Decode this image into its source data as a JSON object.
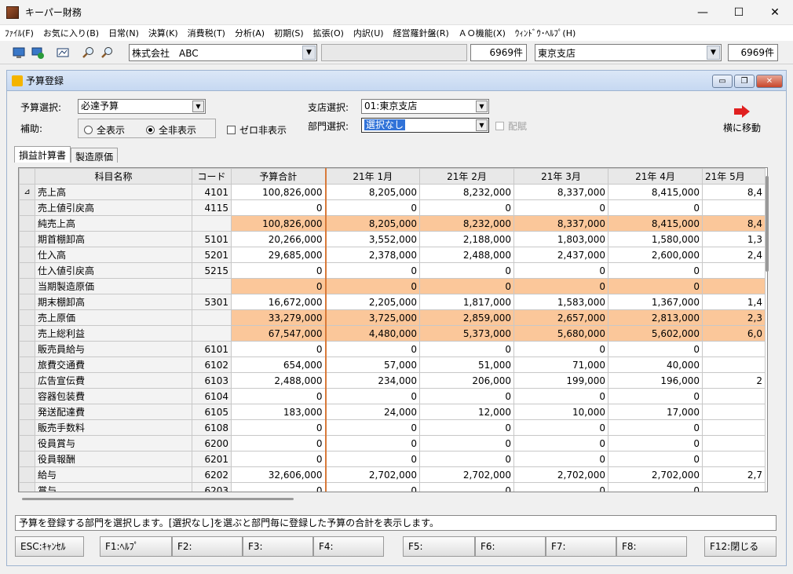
{
  "window": {
    "title": "キーパー財務",
    "min": "—",
    "max": "☐",
    "close": "✕"
  },
  "menu": [
    "ﾌｧｲﾙ(F)",
    "お気に入り(B)",
    "日常(N)",
    "決算(K)",
    "消費税(T)",
    "分析(A)",
    "初期(S)",
    "拡張(O)",
    "内訳(U)",
    "経営羅針盤(R)",
    "ＡＯ機能(X)",
    "ｳｨﾝﾄﾞｳ･ﾍﾙﾌﾟ(H)"
  ],
  "toolbar": {
    "company": "株式会社　ABC",
    "company_count": "6969件",
    "branch": "東京支店",
    "branch_count": "6969件"
  },
  "child": {
    "title": "予算登録"
  },
  "form": {
    "budget_label": "予算選択:",
    "budget_value": "必達予算",
    "aux_label": "補助:",
    "radio_all": "全表示",
    "radio_none": "全非表示",
    "zero_hide": "ゼロ非表示",
    "branch_label": "支店選択:",
    "branch_value": "01:東京支店",
    "dept_label": "部門選択:",
    "dept_value": "選択なし",
    "alloc": "配賦",
    "move_label": "横に移動"
  },
  "tabs": [
    "損益計算書",
    "製造原価"
  ],
  "grid": {
    "headers": [
      "科目名称",
      "コード",
      "予算合計",
      "21年 1月",
      "21年 2月",
      "21年 3月",
      "21年 4月",
      "21年 5月"
    ],
    "rows": [
      {
        "mark": "⊿",
        "name": "売上高",
        "code": "4101",
        "vals": [
          "100,826,000",
          "8,205,000",
          "8,232,000",
          "8,337,000",
          "8,415,000",
          "8,4"
        ],
        "hl": false
      },
      {
        "mark": "",
        "name": "売上値引戻高",
        "code": "4115",
        "vals": [
          "0",
          "0",
          "0",
          "0",
          "0",
          ""
        ],
        "hl": false
      },
      {
        "mark": "",
        "name": "純売上高",
        "code": "",
        "vals": [
          "100,826,000",
          "8,205,000",
          "8,232,000",
          "8,337,000",
          "8,415,000",
          "8,4"
        ],
        "hl": true
      },
      {
        "mark": "",
        "name": "期首棚卸高",
        "code": "5101",
        "vals": [
          "20,266,000",
          "3,552,000",
          "2,188,000",
          "1,803,000",
          "1,580,000",
          "1,3"
        ],
        "hl": false
      },
      {
        "mark": "",
        "name": "仕入高",
        "code": "5201",
        "vals": [
          "29,685,000",
          "2,378,000",
          "2,488,000",
          "2,437,000",
          "2,600,000",
          "2,4"
        ],
        "hl": false
      },
      {
        "mark": "",
        "name": "仕入値引戻高",
        "code": "5215",
        "vals": [
          "0",
          "0",
          "0",
          "0",
          "0",
          ""
        ],
        "hl": false
      },
      {
        "mark": "",
        "name": "当期製造原価",
        "code": "",
        "vals": [
          "0",
          "0",
          "0",
          "0",
          "0",
          ""
        ],
        "hl": true
      },
      {
        "mark": "",
        "name": "期末棚卸高",
        "code": "5301",
        "vals": [
          "16,672,000",
          "2,205,000",
          "1,817,000",
          "1,583,000",
          "1,367,000",
          "1,4"
        ],
        "hl": false
      },
      {
        "mark": "",
        "name": "売上原価",
        "code": "",
        "vals": [
          "33,279,000",
          "3,725,000",
          "2,859,000",
          "2,657,000",
          "2,813,000",
          "2,3"
        ],
        "hl": true
      },
      {
        "mark": "",
        "name": "売上総利益",
        "code": "",
        "vals": [
          "67,547,000",
          "4,480,000",
          "5,373,000",
          "5,680,000",
          "5,602,000",
          "6,0"
        ],
        "hl": true
      },
      {
        "mark": "",
        "name": "販売員給与",
        "code": "6101",
        "vals": [
          "0",
          "0",
          "0",
          "0",
          "0",
          ""
        ],
        "hl": false
      },
      {
        "mark": "",
        "name": "旅費交通費",
        "code": "6102",
        "vals": [
          "654,000",
          "57,000",
          "51,000",
          "71,000",
          "40,000",
          ""
        ],
        "hl": false
      },
      {
        "mark": "",
        "name": "広告宣伝費",
        "code": "6103",
        "vals": [
          "2,488,000",
          "234,000",
          "206,000",
          "199,000",
          "196,000",
          "2"
        ],
        "hl": false
      },
      {
        "mark": "",
        "name": "容器包装費",
        "code": "6104",
        "vals": [
          "0",
          "0",
          "0",
          "0",
          "0",
          ""
        ],
        "hl": false
      },
      {
        "mark": "",
        "name": "発送配達費",
        "code": "6105",
        "vals": [
          "183,000",
          "24,000",
          "12,000",
          "10,000",
          "17,000",
          ""
        ],
        "hl": false
      },
      {
        "mark": "",
        "name": "販売手数料",
        "code": "6108",
        "vals": [
          "0",
          "0",
          "0",
          "0",
          "0",
          ""
        ],
        "hl": false
      },
      {
        "mark": "",
        "name": "役員賞与",
        "code": "6200",
        "vals": [
          "0",
          "0",
          "0",
          "0",
          "0",
          ""
        ],
        "hl": false
      },
      {
        "mark": "",
        "name": "役員報酬",
        "code": "6201",
        "vals": [
          "0",
          "0",
          "0",
          "0",
          "0",
          ""
        ],
        "hl": false
      },
      {
        "mark": "",
        "name": "給与",
        "code": "6202",
        "vals": [
          "32,606,000",
          "2,702,000",
          "2,702,000",
          "2,702,000",
          "2,702,000",
          "2,7"
        ],
        "hl": false
      },
      {
        "mark": "",
        "name": "賞与",
        "code": "6203",
        "vals": [
          "0",
          "0",
          "0",
          "0",
          "0",
          ""
        ],
        "hl": false
      }
    ]
  },
  "status": "予算を登録する部門を選択します。[選択なし]を選ぶと部門毎に登録した予算の合計を表示します。",
  "fkeys": [
    "ESC:ｷｬﾝｾﾙ",
    "F1:ﾍﾙﾌﾟ",
    "F2:",
    "F3:",
    "F4:",
    "F5:",
    "F6:",
    "F7:",
    "F8:",
    "F12:閉じる"
  ]
}
